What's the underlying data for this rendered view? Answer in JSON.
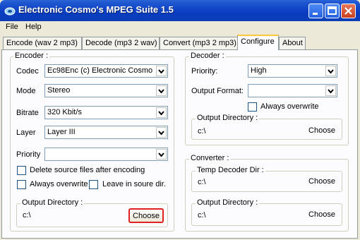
{
  "window": {
    "title": "Electronic Cosmo's MPEG Suite 1.5"
  },
  "menu": [
    "File",
    "Help"
  ],
  "tabs": [
    "Encode (wav 2 mp3)",
    "Decode (mp3 2 wav)",
    "Convert (mp3 2 mp3)",
    "Configure",
    "About"
  ],
  "active_tab": "Configure",
  "encoder": {
    "group_label": "Encoder :",
    "codec": {
      "label": "Codec",
      "value": "Ec98Enc  (c) Electronic Cosmo"
    },
    "mode": {
      "label": "Mode",
      "value": "Stereo"
    },
    "bitrate": {
      "label": "Bitrate",
      "value": "320 Kbit/s"
    },
    "layer": {
      "label": "Layer",
      "value": "Layer III"
    },
    "priority": {
      "label": "Priority",
      "value": ""
    },
    "delete_source": {
      "label": "Delete source files after encoding",
      "checked": false
    },
    "always_overwrite": {
      "label": "Always overwrite",
      "checked": false
    },
    "leave_in_source": {
      "label": "Leave in soure dir.",
      "checked": false
    },
    "output_dir": {
      "label": "Output Directory :",
      "path": "c:\\",
      "button": "Choose"
    }
  },
  "decoder": {
    "group_label": "Decoder :",
    "priority": {
      "label": "Priority:",
      "value": "High"
    },
    "output_format": {
      "label": "Output Format:",
      "value": ""
    },
    "always_overwrite": {
      "label": "Always overwrite",
      "checked": false
    },
    "output_dir": {
      "label": "Output Directory :",
      "path": "c:\\",
      "button": "Choose"
    }
  },
  "converter": {
    "group_label": "Converter :",
    "temp_dir": {
      "label": "Temp Decoder Dir :",
      "path": "c:\\",
      "button": "Choose"
    },
    "output_dir": {
      "label": "Output Directory :",
      "path": "c:\\",
      "button": "Choose"
    }
  },
  "highlight_color": "#e02020"
}
